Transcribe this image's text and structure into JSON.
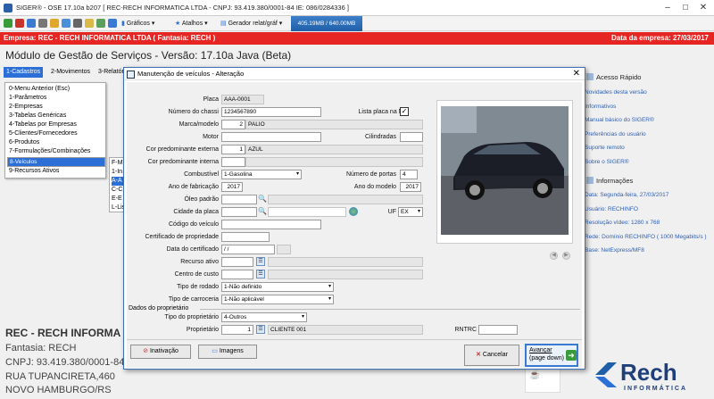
{
  "window": {
    "title": "SIGER® - OSE 17.10a b207 [ REC-RECH INFORMATICA LTDA - CNPJ: 93.419.380/0001-84 IE: 086/0284336 ]"
  },
  "toolbar": {
    "graficos": "Gráficos",
    "atalhos": "Atalhos",
    "gerador": "Gerador relat/gráf",
    "memory": "405.19MB / 640.00MB"
  },
  "redbar": {
    "empresa": "Empresa:  REC - RECH INFORMATICA LTDA ( Fantasia: RECH )",
    "data": "Data da empresa: 27/03/2017"
  },
  "module_title": "Módulo de Gestão de Serviços - Versão: 17.10a Java (Beta)",
  "menubar": [
    "1-Cadastros",
    "2-Movimentos",
    "3-Relatór"
  ],
  "dropdown": [
    "0-Menu Anterior (Esc)",
    "1-Parâmetros",
    "2-Empresas",
    "3-Tabelas Genéricas",
    "4-Tabelas por Empresas",
    "5-Clientes/Fornecedores",
    "6-Produtos",
    "7-Formulações/Combinações",
    "8-Veículos",
    "9-Recursos Ativos"
  ],
  "submenu": [
    "F-M",
    "1-In",
    "A-A",
    "C-C",
    "E-E",
    "L-Lis"
  ],
  "company": {
    "name": "REC - RECH INFORMA",
    "fantasia": "Fantasia: RECH",
    "cnpj": "CNPJ: 93.419.380/0001-84",
    "rua": "RUA TUPANCIRETA,460",
    "cidade": "NOVO HAMBURGO/RS"
  },
  "right_panel": {
    "acesso": "Acesso Rápido",
    "links": [
      "Novidades desta versão",
      "Informativos",
      "Manual básico do SIGER®",
      "Preferências do usuário",
      "Suporte remoto",
      "Sobre o SIGER®"
    ],
    "info_title": "Informações",
    "info": [
      "Data: Segunda-feira, 27/03/2017",
      "Usuário:  RECHINFO",
      "Resolução vídeo:  1280 x 768",
      "Rede: Domínio RECHINFO ( 1000 Megabits/s )",
      "Base: NetExpress/MF8"
    ],
    "logo": "Rech",
    "logo_sub": "INFORMÁTICA"
  },
  "dialog": {
    "title": "Manutenção de veículos - Alteração",
    "labels": {
      "placa": "Placa",
      "chassi": "Número do chassi",
      "marca": "Marca/modelo",
      "motor": "Motor",
      "cor_ext": "Cor predominante externa",
      "cor_int": "Cor predominante interna",
      "combustivel": "Combustível",
      "ano_fab": "Ano de fabricação",
      "oleo": "Óleo padrão",
      "cidade": "Cidade da placa",
      "codigo": "Código do veículo",
      "certificado": "Certificado de propriedade",
      "data_cert": "Data do certificado",
      "recurso": "Recurso ativo",
      "centro": "Centro de custo",
      "rodado": "Tipo de rodado",
      "carroceria": "Tipo de carroceria",
      "dados_prop": "Dados do proprietário",
      "tipo_prop": "Tipo do proprietário",
      "proprietario": "Proprietário",
      "lista_placa": "Lista placa na NF",
      "cilindradas": "Cilindradas",
      "num_portas": "Número de portas",
      "ano_modelo": "Ano do modelo",
      "uf": "UF",
      "rntrc": "RNTRC"
    },
    "values": {
      "placa": "AAA-0001",
      "chassi": "1234567890",
      "marca_cod": "2",
      "marca_desc": "PALIO",
      "cor_ext_cod": "1",
      "cor_ext_desc": "AZUL",
      "combustivel": "1-Gasolina",
      "ano_fab": "2017",
      "uf": "EX",
      "num_portas": "4",
      "ano_modelo": "2017",
      "data_cert": "/  /",
      "rodado": "1-Não definido",
      "carroceria": "1-Não aplicável",
      "tipo_prop": "4-Outros",
      "prop_cod": "1",
      "prop_desc": "CLIENTE 001"
    },
    "buttons": {
      "inativacao": "Inativação",
      "imagens": "Imagens",
      "cancelar": "Cancelar",
      "avancar": "Avançar",
      "avancar_sub": "(page down)"
    }
  },
  "colors": {
    "red": "#e52622",
    "blue": "#2c6fd6",
    "link": "#2c5fb5"
  }
}
